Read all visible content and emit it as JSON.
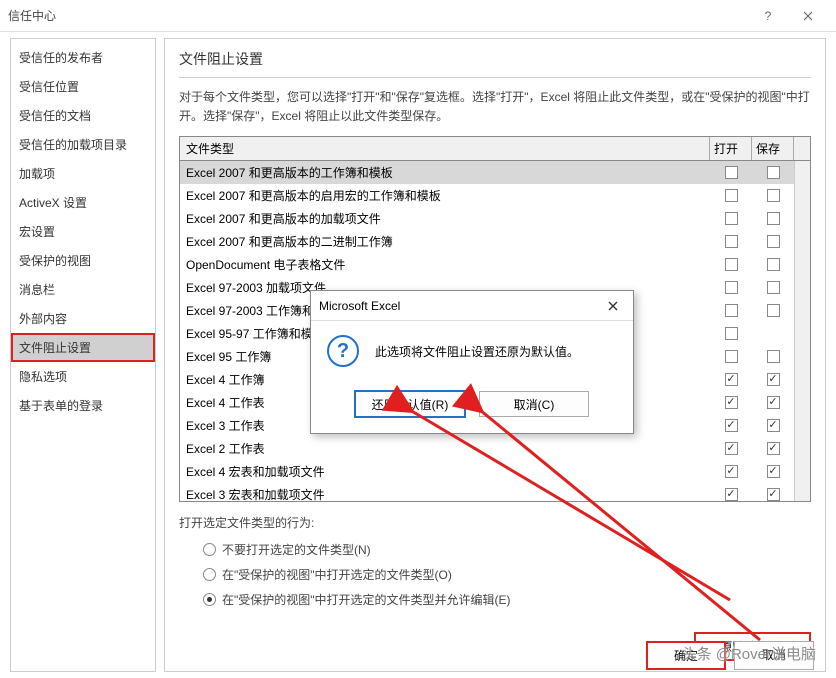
{
  "window": {
    "title": "信任中心"
  },
  "sidebar": {
    "items": [
      {
        "label": "受信任的发布者"
      },
      {
        "label": "受信任位置"
      },
      {
        "label": "受信任的文档"
      },
      {
        "label": "受信任的加载项目录"
      },
      {
        "label": "加载项"
      },
      {
        "label": "ActiveX 设置"
      },
      {
        "label": "宏设置"
      },
      {
        "label": "受保护的视图"
      },
      {
        "label": "消息栏"
      },
      {
        "label": "外部内容"
      },
      {
        "label": "文件阻止设置"
      },
      {
        "label": "隐私选项"
      },
      {
        "label": "基于表单的登录"
      }
    ]
  },
  "main": {
    "section_title": "文件阻止设置",
    "description": "对于每个文件类型，您可以选择\"打开\"和\"保存\"复选框。选择\"打开\"，Excel 将阻止此文件类型，或在\"受保护的视图\"中打开。选择\"保存\"，Excel 将阻止以此文件类型保存。",
    "table": {
      "col_type": "文件类型",
      "col_open": "打开",
      "col_save": "保存",
      "rows": [
        {
          "label": "Excel 2007 和更高版本的工作簿和模板",
          "open": false,
          "save": false,
          "selected": true
        },
        {
          "label": "Excel 2007 和更高版本的启用宏的工作簿和模板",
          "open": false,
          "save": false
        },
        {
          "label": "Excel 2007 和更高版本的加载项文件",
          "open": false,
          "save": false
        },
        {
          "label": "Excel 2007 和更高版本的二进制工作簿",
          "open": false,
          "save": false
        },
        {
          "label": "OpenDocument 电子表格文件",
          "open": false,
          "save": false
        },
        {
          "label": "Excel 97-2003 加载项文件",
          "open": false,
          "save": false
        },
        {
          "label": "Excel 97-2003 工作簿和模板",
          "open": false,
          "save": false
        },
        {
          "label": "Excel 95-97 工作簿和模板",
          "open": false,
          "save": null
        },
        {
          "label": "Excel 95 工作簿",
          "open": false,
          "save": false
        },
        {
          "label": "Excel 4 工作簿",
          "open": true,
          "save": true
        },
        {
          "label": "Excel 4 工作表",
          "open": true,
          "save": true
        },
        {
          "label": "Excel 3 工作表",
          "open": true,
          "save": true
        },
        {
          "label": "Excel 2 工作表",
          "open": true,
          "save": true
        },
        {
          "label": "Excel 4 宏表和加载项文件",
          "open": true,
          "save": true
        },
        {
          "label": "Excel 3 宏表和加载项文件",
          "open": true,
          "save": true
        }
      ]
    },
    "behavior": {
      "label": "打开选定文件类型的行为:",
      "options": [
        {
          "label": "不要打开选定的文件类型(N)",
          "selected": false
        },
        {
          "label": "在\"受保护的视图\"中打开选定的文件类型(O)",
          "selected": false
        },
        {
          "label": "在\"受保护的视图\"中打开选定的文件类型并允许编辑(E)",
          "selected": true
        }
      ]
    },
    "restore_button": "还原默认设置(R)",
    "ok_button": "确定",
    "cancel_button": "取消"
  },
  "modal": {
    "title": "Microsoft Excel",
    "message": "此选项将文件阻止设置还原为默认值。",
    "primary": "还原默认值(R)",
    "cancel": "取消(C)"
  },
  "watermark": "头条 @Rover说电脑"
}
